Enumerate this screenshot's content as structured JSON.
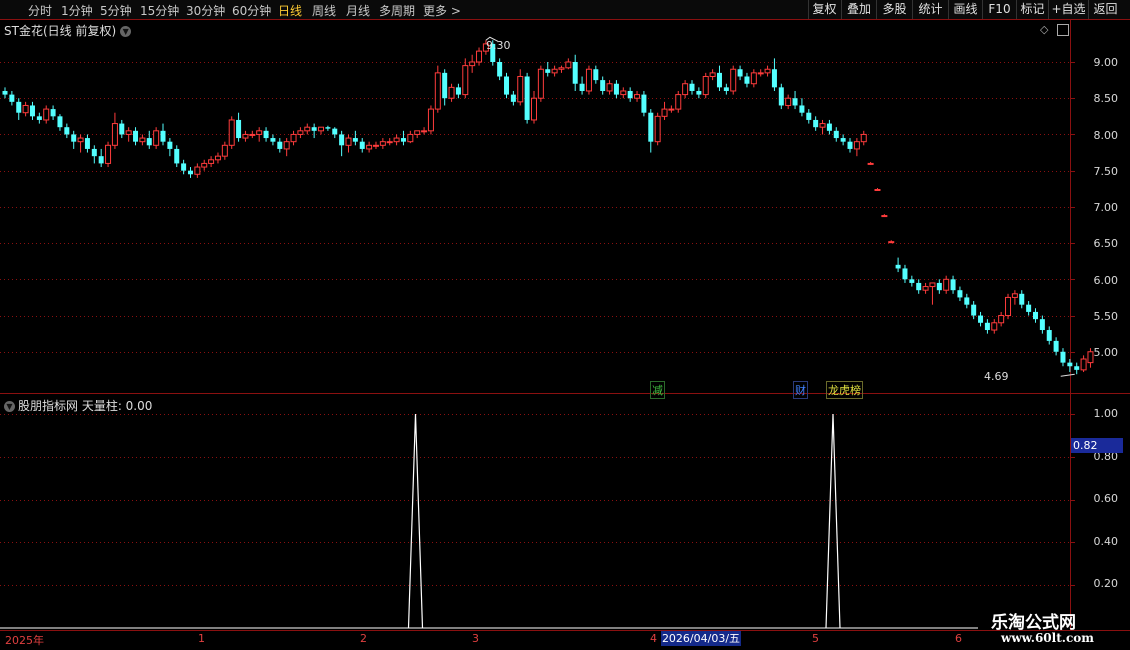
{
  "periods": [
    "分时",
    "1分钟",
    "5分钟",
    "15分钟",
    "30分钟",
    "60分钟",
    "日线",
    "周线",
    "月线",
    "多周期",
    "更多 >"
  ],
  "active_period": "日线",
  "right_buttons": [
    "复权",
    "叠加",
    "多股",
    "统计",
    "画线",
    "F10",
    "标记",
    "+自选",
    "返回"
  ],
  "main_title": "ST金花(日线 前复权)",
  "sub_title": "股朋指标网 天量柱: 0.00",
  "price_axis": [
    "9.00",
    "8.50",
    "8.00",
    "7.50",
    "7.00",
    "6.50",
    "6.00",
    "5.50",
    "5.00"
  ],
  "indicator_axis": [
    "1.00",
    "0.80",
    "0.60",
    "0.40",
    "0.20"
  ],
  "indicator_current": "0.82",
  "high_label": "9.30",
  "low_label": "4.69",
  "event_tags": [
    {
      "text": "减",
      "color": "#40c040"
    },
    {
      "text": "财",
      "color": "#4080ff"
    },
    {
      "text": "龙虎榜",
      "color": "#e0e040"
    }
  ],
  "x_axis": [
    "2025年",
    "1",
    "2",
    "3",
    "4",
    "5",
    "6"
  ],
  "highlight_date": "2026/04/03/五",
  "watermark": {
    "line1": "乐淘公式网",
    "line2": "www.60lt.com"
  },
  "colors": {
    "up": "#ff3c3c",
    "down": "#54ffff",
    "grid": "#8a1010"
  },
  "chart_data": {
    "type": "candlestick",
    "price_range": [
      4.6,
      9.4
    ],
    "candles": [
      [
        8.6,
        8.65,
        8.5,
        8.55
      ],
      [
        8.55,
        8.6,
        8.4,
        8.45
      ],
      [
        8.45,
        8.5,
        8.2,
        8.3
      ],
      [
        8.3,
        8.45,
        8.25,
        8.4
      ],
      [
        8.4,
        8.45,
        8.2,
        8.25
      ],
      [
        8.25,
        8.3,
        8.15,
        8.2
      ],
      [
        8.2,
        8.4,
        8.15,
        8.35
      ],
      [
        8.35,
        8.4,
        8.2,
        8.25
      ],
      [
        8.25,
        8.28,
        8.05,
        8.1
      ],
      [
        8.1,
        8.15,
        7.95,
        8.0
      ],
      [
        8.0,
        8.05,
        7.8,
        7.9
      ],
      [
        7.9,
        8.0,
        7.75,
        7.95
      ],
      [
        7.95,
        8.0,
        7.75,
        7.8
      ],
      [
        7.8,
        7.85,
        7.6,
        7.7
      ],
      [
        7.7,
        7.8,
        7.55,
        7.6
      ],
      [
        7.6,
        7.9,
        7.55,
        7.85
      ],
      [
        7.85,
        8.3,
        7.8,
        8.15
      ],
      [
        8.15,
        8.2,
        7.95,
        8.0
      ],
      [
        8.0,
        8.1,
        7.9,
        8.05
      ],
      [
        8.05,
        8.1,
        7.85,
        7.9
      ],
      [
        7.9,
        8.0,
        7.85,
        7.95
      ],
      [
        7.95,
        8.05,
        7.8,
        7.85
      ],
      [
        7.85,
        8.1,
        7.8,
        8.05
      ],
      [
        8.05,
        8.15,
        7.85,
        7.9
      ],
      [
        7.9,
        7.95,
        7.7,
        7.8
      ],
      [
        7.8,
        7.85,
        7.55,
        7.6
      ],
      [
        7.6,
        7.65,
        7.45,
        7.5
      ],
      [
        7.5,
        7.55,
        7.4,
        7.45
      ],
      [
        7.45,
        7.6,
        7.4,
        7.55
      ],
      [
        7.55,
        7.65,
        7.5,
        7.6
      ],
      [
        7.6,
        7.7,
        7.55,
        7.65
      ],
      [
        7.65,
        7.75,
        7.6,
        7.7
      ],
      [
        7.7,
        7.9,
        7.65,
        7.85
      ],
      [
        7.85,
        8.25,
        7.8,
        8.2
      ],
      [
        8.2,
        8.3,
        7.9,
        7.95
      ],
      [
        7.95,
        8.05,
        7.9,
        8.0
      ],
      [
        8.0,
        8.05,
        7.95,
        8.0
      ],
      [
        8.0,
        8.1,
        7.9,
        8.05
      ],
      [
        8.05,
        8.1,
        7.9,
        7.95
      ],
      [
        7.95,
        8.0,
        7.85,
        7.9
      ],
      [
        7.9,
        7.95,
        7.75,
        7.8
      ],
      [
        7.8,
        7.95,
        7.7,
        7.9
      ],
      [
        7.9,
        8.05,
        7.85,
        8.0
      ],
      [
        8.0,
        8.1,
        7.95,
        8.05
      ],
      [
        8.05,
        8.15,
        8.0,
        8.1
      ],
      [
        8.1,
        8.15,
        7.95,
        8.05
      ],
      [
        8.05,
        8.1,
        8.0,
        8.1
      ],
      [
        8.1,
        8.12,
        8.05,
        8.08
      ],
      [
        8.08,
        8.1,
        7.95,
        8.0
      ],
      [
        8.0,
        8.05,
        7.7,
        7.85
      ],
      [
        7.85,
        8.0,
        7.75,
        7.95
      ],
      [
        7.95,
        8.05,
        7.85,
        7.9
      ],
      [
        7.9,
        7.95,
        7.75,
        7.8
      ],
      [
        7.8,
        7.9,
        7.75,
        7.85
      ],
      [
        7.85,
        7.9,
        7.8,
        7.85
      ],
      [
        7.85,
        7.95,
        7.8,
        7.9
      ],
      [
        7.9,
        7.95,
        7.85,
        7.9
      ],
      [
        7.9,
        8.0,
        7.85,
        7.95
      ],
      [
        7.95,
        8.05,
        7.85,
        7.9
      ],
      [
        7.9,
        8.05,
        7.88,
        8.0
      ],
      [
        8.0,
        8.05,
        7.95,
        8.05
      ],
      [
        8.05,
        8.1,
        8.0,
        8.05
      ],
      [
        8.05,
        8.4,
        8.0,
        8.35
      ],
      [
        8.35,
        8.95,
        8.3,
        8.85
      ],
      [
        8.85,
        8.9,
        8.4,
        8.5
      ],
      [
        8.5,
        8.7,
        8.45,
        8.65
      ],
      [
        8.65,
        8.7,
        8.5,
        8.55
      ],
      [
        8.55,
        9.05,
        8.5,
        8.95
      ],
      [
        8.95,
        9.1,
        8.85,
        9.0
      ],
      [
        9.0,
        9.2,
        8.95,
        9.15
      ],
      [
        9.15,
        9.3,
        9.1,
        9.25
      ],
      [
        9.25,
        9.3,
        8.95,
        9.0
      ],
      [
        9.0,
        9.05,
        8.75,
        8.8
      ],
      [
        8.8,
        8.85,
        8.5,
        8.55
      ],
      [
        8.55,
        8.6,
        8.4,
        8.45
      ],
      [
        8.45,
        8.9,
        8.4,
        8.8
      ],
      [
        8.8,
        8.85,
        8.15,
        8.2
      ],
      [
        8.2,
        8.6,
        8.15,
        8.5
      ],
      [
        8.5,
        8.95,
        8.45,
        8.9
      ],
      [
        8.9,
        9.0,
        8.8,
        8.85
      ],
      [
        8.85,
        8.95,
        8.8,
        8.9
      ],
      [
        8.9,
        8.95,
        8.85,
        8.92
      ],
      [
        8.92,
        9.05,
        8.9,
        9.0
      ],
      [
        9.0,
        9.1,
        8.6,
        8.7
      ],
      [
        8.7,
        8.8,
        8.55,
        8.6
      ],
      [
        8.6,
        8.95,
        8.55,
        8.9
      ],
      [
        8.9,
        8.95,
        8.7,
        8.75
      ],
      [
        8.75,
        8.8,
        8.55,
        8.6
      ],
      [
        8.6,
        8.75,
        8.55,
        8.7
      ],
      [
        8.7,
        8.75,
        8.5,
        8.55
      ],
      [
        8.55,
        8.65,
        8.5,
        8.6
      ],
      [
        8.6,
        8.65,
        8.45,
        8.5
      ],
      [
        8.5,
        8.6,
        8.45,
        8.55
      ],
      [
        8.55,
        8.6,
        8.25,
        8.3
      ],
      [
        8.3,
        8.35,
        7.75,
        7.9
      ],
      [
        7.9,
        8.3,
        7.85,
        8.25
      ],
      [
        8.25,
        8.45,
        8.2,
        8.35
      ],
      [
        8.35,
        8.4,
        8.3,
        8.35
      ],
      [
        8.35,
        8.6,
        8.3,
        8.55
      ],
      [
        8.55,
        8.75,
        8.5,
        8.7
      ],
      [
        8.7,
        8.75,
        8.55,
        8.6
      ],
      [
        8.6,
        8.65,
        8.5,
        8.55
      ],
      [
        8.55,
        8.85,
        8.5,
        8.8
      ],
      [
        8.8,
        8.9,
        8.75,
        8.85
      ],
      [
        8.85,
        8.95,
        8.6,
        8.65
      ],
      [
        8.65,
        8.7,
        8.55,
        8.6
      ],
      [
        8.6,
        8.95,
        8.55,
        8.9
      ],
      [
        8.9,
        8.95,
        8.75,
        8.8
      ],
      [
        8.8,
        8.85,
        8.65,
        8.7
      ],
      [
        8.7,
        8.9,
        8.65,
        8.85
      ],
      [
        8.85,
        8.9,
        8.8,
        8.85
      ],
      [
        8.85,
        8.95,
        8.8,
        8.9
      ],
      [
        8.9,
        9.05,
        8.6,
        8.65
      ],
      [
        8.65,
        8.7,
        8.35,
        8.4
      ],
      [
        8.4,
        8.55,
        8.35,
        8.5
      ],
      [
        8.5,
        8.6,
        8.35,
        8.4
      ],
      [
        8.4,
        8.5,
        8.25,
        8.3
      ],
      [
        8.3,
        8.35,
        8.15,
        8.2
      ],
      [
        8.2,
        8.25,
        8.05,
        8.1
      ],
      [
        8.1,
        8.2,
        8.0,
        8.15
      ],
      [
        8.15,
        8.2,
        8.0,
        8.05
      ],
      [
        8.05,
        8.1,
        7.9,
        7.95
      ],
      [
        7.95,
        8.0,
        7.85,
        7.9
      ],
      [
        7.9,
        7.95,
        7.75,
        7.8
      ],
      [
        7.8,
        7.95,
        7.7,
        7.9
      ],
      [
        7.9,
        8.05,
        7.85,
        8.0
      ],
      [
        7.6,
        7.62,
        7.58,
        7.6
      ],
      [
        7.24,
        7.26,
        7.22,
        7.24
      ],
      [
        6.88,
        6.9,
        6.86,
        6.88
      ],
      [
        6.52,
        6.54,
        6.5,
        6.52
      ],
      [
        6.2,
        6.3,
        6.1,
        6.15
      ],
      [
        6.15,
        6.2,
        5.95,
        6.0
      ],
      [
        6.0,
        6.05,
        5.9,
        5.95
      ],
      [
        5.95,
        6.0,
        5.8,
        5.85
      ],
      [
        5.85,
        5.95,
        5.8,
        5.9
      ],
      [
        5.9,
        5.95,
        5.65,
        5.95
      ],
      [
        5.95,
        6.0,
        5.8,
        5.85
      ],
      [
        5.85,
        6.05,
        5.8,
        6.0
      ],
      [
        6.0,
        6.05,
        5.8,
        5.85
      ],
      [
        5.85,
        5.9,
        5.7,
        5.75
      ],
      [
        5.75,
        5.8,
        5.6,
        5.65
      ],
      [
        5.65,
        5.7,
        5.45,
        5.5
      ],
      [
        5.5,
        5.55,
        5.35,
        5.4
      ],
      [
        5.4,
        5.45,
        5.25,
        5.3
      ],
      [
        5.3,
        5.45,
        5.25,
        5.4
      ],
      [
        5.4,
        5.55,
        5.35,
        5.5
      ],
      [
        5.5,
        5.8,
        5.45,
        5.75
      ],
      [
        5.75,
        5.85,
        5.65,
        5.8
      ],
      [
        5.8,
        5.85,
        5.6,
        5.65
      ],
      [
        5.65,
        5.7,
        5.5,
        5.55
      ],
      [
        5.55,
        5.6,
        5.4,
        5.45
      ],
      [
        5.45,
        5.5,
        5.25,
        5.3
      ],
      [
        5.3,
        5.35,
        5.1,
        5.15
      ],
      [
        5.15,
        5.2,
        4.95,
        5.0
      ],
      [
        5.0,
        5.05,
        4.8,
        4.85
      ],
      [
        4.85,
        4.9,
        4.72,
        4.8
      ],
      [
        4.8,
        4.85,
        4.69,
        4.75
      ],
      [
        4.75,
        4.95,
        4.72,
        4.9
      ],
      [
        4.85,
        5.05,
        4.78,
        5.0
      ]
    ]
  }
}
